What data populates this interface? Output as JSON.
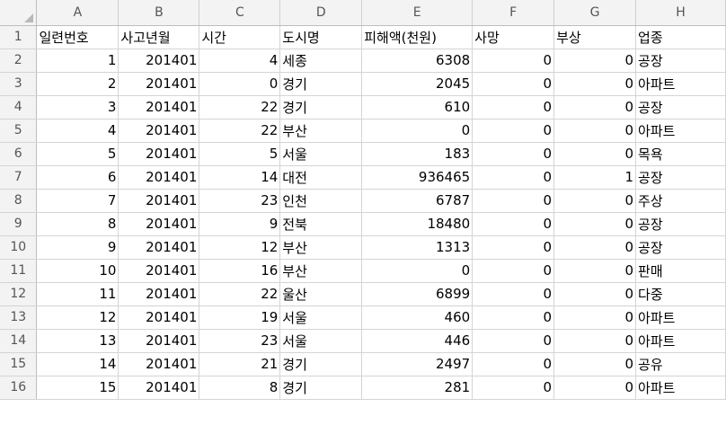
{
  "columns": [
    "A",
    "B",
    "C",
    "D",
    "E",
    "F",
    "G",
    "H"
  ],
  "row_numbers": [
    "1",
    "2",
    "3",
    "4",
    "5",
    "6",
    "7",
    "8",
    "9",
    "10",
    "11",
    "12",
    "13",
    "14",
    "15",
    "16"
  ],
  "header": [
    "일련번호",
    "사고년월",
    "시간",
    "도시명",
    "피해액(천원)",
    "사망",
    "부상",
    "업종"
  ],
  "rows": [
    [
      "1",
      "201401",
      "4",
      "세종",
      "6308",
      "0",
      "0",
      "공장"
    ],
    [
      "2",
      "201401",
      "0",
      "경기",
      "2045",
      "0",
      "0",
      "아파트"
    ],
    [
      "3",
      "201401",
      "22",
      "경기",
      "610",
      "0",
      "0",
      "공장"
    ],
    [
      "4",
      "201401",
      "22",
      "부산",
      "0",
      "0",
      "0",
      "아파트"
    ],
    [
      "5",
      "201401",
      "5",
      "서울",
      "183",
      "0",
      "0",
      "목욕"
    ],
    [
      "6",
      "201401",
      "14",
      "대전",
      "936465",
      "0",
      "1",
      "공장"
    ],
    [
      "7",
      "201401",
      "23",
      "인천",
      "6787",
      "0",
      "0",
      "주상"
    ],
    [
      "8",
      "201401",
      "9",
      "전북",
      "18480",
      "0",
      "0",
      "공장"
    ],
    [
      "9",
      "201401",
      "12",
      "부산",
      "1313",
      "0",
      "0",
      "공장"
    ],
    [
      "10",
      "201401",
      "16",
      "부산",
      "0",
      "0",
      "0",
      "판매"
    ],
    [
      "11",
      "201401",
      "22",
      "울산",
      "6899",
      "0",
      "0",
      "다중"
    ],
    [
      "12",
      "201401",
      "19",
      "서울",
      "460",
      "0",
      "0",
      "아파트"
    ],
    [
      "13",
      "201401",
      "23",
      "서울",
      "446",
      "0",
      "0",
      "아파트"
    ],
    [
      "14",
      "201401",
      "21",
      "경기",
      "2497",
      "0",
      "0",
      "공유"
    ],
    [
      "15",
      "201401",
      "8",
      "경기",
      "281",
      "0",
      "0",
      "아파트"
    ]
  ]
}
